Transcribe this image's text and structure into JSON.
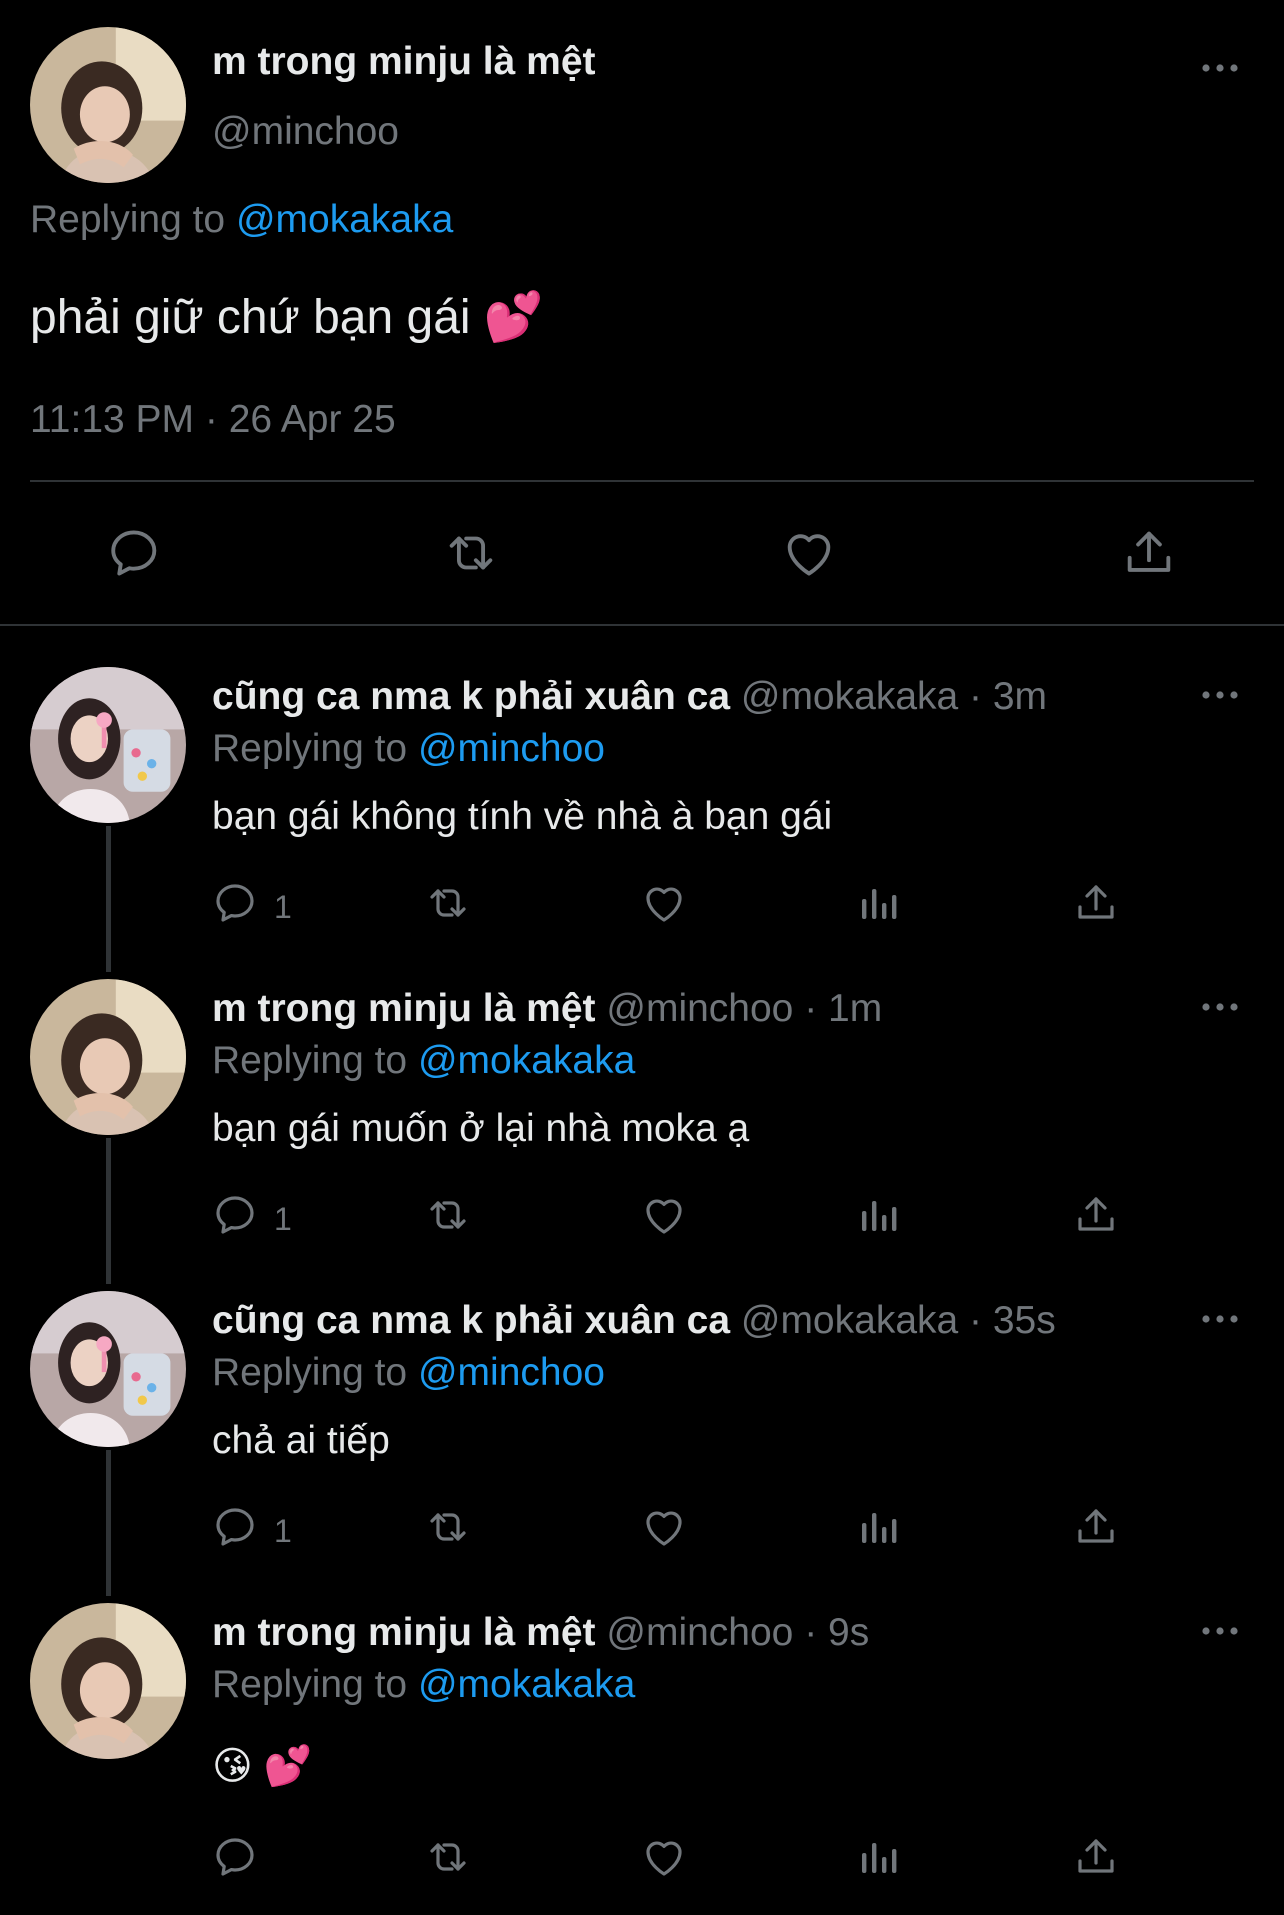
{
  "main_tweet": {
    "display_name": "m trong minju là mệt",
    "handle": "@minchoo",
    "replying_prefix": "Replying to ",
    "replying_to": "@mokakaka",
    "text": "phải giữ chứ bạn gái 💕",
    "timestamp": "11:13 PM · 26 Apr 25",
    "actions": [
      "reply-icon",
      "retweet-icon",
      "like-icon",
      "share-icon"
    ]
  },
  "replies": [
    {
      "display_name": "cũng ca nma k phải xuân ca",
      "handle": "@mokakaka",
      "time": "· 3m",
      "replying_prefix": "Replying to ",
      "replying_to": "@minchoo",
      "text": "bạn gái không tính về nhà à bạn gái",
      "reply_count": "1"
    },
    {
      "display_name": "m trong minju là mệt",
      "handle": "@minchoo",
      "time": "· 1m",
      "replying_prefix": "Replying to ",
      "replying_to": "@mokakaka",
      "text": "bạn gái muốn ở lại nhà moka ạ",
      "reply_count": "1"
    },
    {
      "display_name": "cũng ca nma k phải xuân ca",
      "handle": "@mokakaka",
      "time": "· 35s",
      "replying_prefix": "Replying to ",
      "replying_to": "@minchoo",
      "text": "chả ai tiếp",
      "reply_count": "1"
    },
    {
      "display_name": "m trong minju là mệt",
      "handle": "@minchoo",
      "time": "· 9s",
      "replying_prefix": "Replying to ",
      "replying_to": "@mokakaka",
      "text": "😘 💕",
      "reply_count": ""
    }
  ],
  "colors": {
    "background": "#000000",
    "text": "#e7e9ea",
    "muted": "#71767b",
    "link": "#1d9bf0",
    "divider": "#2f3336"
  }
}
